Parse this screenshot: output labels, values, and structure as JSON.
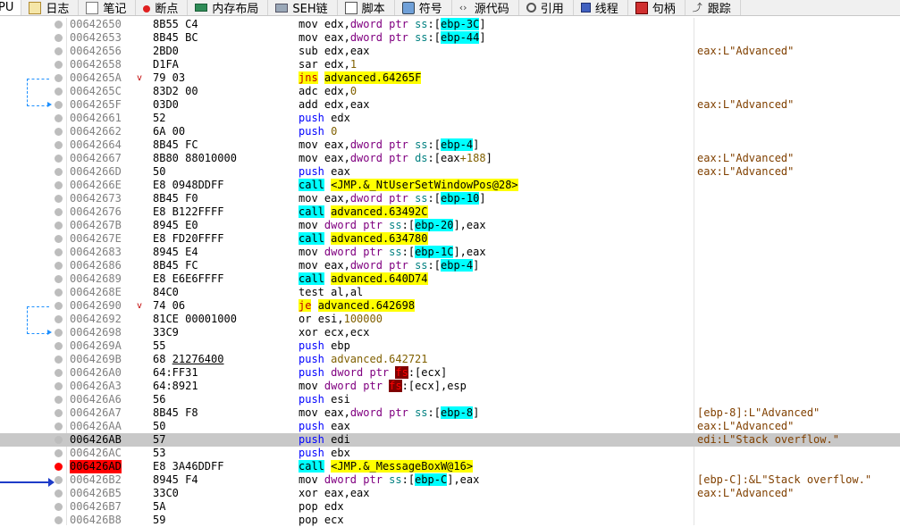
{
  "tabs": [
    {
      "label": "PU",
      "icon": "cpu-icon"
    },
    {
      "label": "日志",
      "icon": "log-icon"
    },
    {
      "label": "笔记",
      "icon": "notes-icon"
    },
    {
      "label": "断点",
      "icon": "breakpoint-icon"
    },
    {
      "label": "内存布局",
      "icon": "memory-map-icon"
    },
    {
      "label": "SEH链",
      "icon": "seh-chain-icon"
    },
    {
      "label": "脚本",
      "icon": "script-icon"
    },
    {
      "label": "符号",
      "icon": "symbols-icon"
    },
    {
      "label": "源代码",
      "icon": "source-icon"
    },
    {
      "label": "引用",
      "icon": "references-icon"
    },
    {
      "label": "线程",
      "icon": "threads-icon"
    },
    {
      "label": "句柄",
      "icon": "handles-icon"
    },
    {
      "label": "跟踪",
      "icon": "trace-icon"
    }
  ],
  "rows": [
    {
      "addr": "00642650",
      "bytes": "8B55 C4",
      "dis": [
        [
          "k",
          "mov "
        ],
        [
          "r",
          "edx"
        ],
        [
          "k",
          ","
        ],
        [
          "p",
          "dword ptr "
        ],
        [
          "s",
          "ss"
        ],
        [
          "k",
          ":"
        ],
        [
          "c",
          "["
        ],
        [
          "ch",
          "ebp-3C"
        ],
        [
          "c",
          "]"
        ]
      ],
      "cmt": ""
    },
    {
      "addr": "00642653",
      "bytes": "8B45 BC",
      "dis": [
        [
          "k",
          "mov "
        ],
        [
          "r",
          "eax"
        ],
        [
          "k",
          ","
        ],
        [
          "p",
          "dword ptr "
        ],
        [
          "s",
          "ss"
        ],
        [
          "k",
          ":"
        ],
        [
          "c",
          "["
        ],
        [
          "ch",
          "ebp-44"
        ],
        [
          "c",
          "]"
        ]
      ],
      "cmt": ""
    },
    {
      "addr": "00642656",
      "bytes": "2BD0",
      "dis": [
        [
          "k",
          "sub "
        ],
        [
          "r",
          "edx"
        ],
        [
          "k",
          ","
        ],
        [
          "r",
          "eax"
        ]
      ],
      "cmt": "eax:L\"Advanced\""
    },
    {
      "addr": "00642658",
      "bytes": "D1FA",
      "dis": [
        [
          "k",
          "sar "
        ],
        [
          "r",
          "edx"
        ],
        [
          "k",
          ","
        ],
        [
          "n",
          "1"
        ]
      ],
      "cmt": ""
    },
    {
      "addr": "0064265A",
      "bytes": "79 03",
      "mark": "v",
      "dis": [
        [
          "yj",
          "jns"
        ],
        [
          "k",
          " "
        ],
        [
          "yt",
          "advanced.64265F"
        ]
      ],
      "cmt": ""
    },
    {
      "addr": "0064265C",
      "bytes": "83D2 00",
      "dis": [
        [
          "k",
          "adc "
        ],
        [
          "r",
          "edx"
        ],
        [
          "k",
          ","
        ],
        [
          "n",
          "0"
        ]
      ],
      "cmt": ""
    },
    {
      "addr": "0064265F",
      "bytes": "03D0",
      "dis": [
        [
          "k",
          "add "
        ],
        [
          "r",
          "edx"
        ],
        [
          "k",
          ","
        ],
        [
          "r",
          "eax"
        ]
      ],
      "cmt": "eax:L\"Advanced\""
    },
    {
      "addr": "00642661",
      "bytes": "52",
      "dis": [
        [
          "b",
          "push "
        ],
        [
          "r",
          "edx"
        ]
      ],
      "cmt": ""
    },
    {
      "addr": "00642662",
      "bytes": "6A 00",
      "dis": [
        [
          "b",
          "push "
        ],
        [
          "n",
          "0"
        ]
      ],
      "cmt": ""
    },
    {
      "addr": "00642664",
      "bytes": "8B45 FC",
      "dis": [
        [
          "k",
          "mov "
        ],
        [
          "r",
          "eax"
        ],
        [
          "k",
          ","
        ],
        [
          "p",
          "dword ptr "
        ],
        [
          "s",
          "ss"
        ],
        [
          "k",
          ":"
        ],
        [
          "c",
          "["
        ],
        [
          "ch",
          "ebp-4"
        ],
        [
          "c",
          "]"
        ]
      ],
      "cmt": ""
    },
    {
      "addr": "00642667",
      "bytes": "8B80 88010000",
      "dis": [
        [
          "k",
          "mov "
        ],
        [
          "r",
          "eax"
        ],
        [
          "k",
          ","
        ],
        [
          "p",
          "dword ptr "
        ],
        [
          "s",
          "ds"
        ],
        [
          "k",
          ":["
        ],
        [
          "r",
          "eax"
        ],
        [
          "n",
          "+188"
        ],
        [
          "k",
          "]"
        ]
      ],
      "cmt": "eax:L\"Advanced\""
    },
    {
      "addr": "0064266D",
      "bytes": "50",
      "dis": [
        [
          "b",
          "push "
        ],
        [
          "r",
          "eax"
        ]
      ],
      "cmt": "eax:L\"Advanced\""
    },
    {
      "addr": "0064266E",
      "bytes": "E8 0948DDFF",
      "dis": [
        [
          "cc",
          "call"
        ],
        [
          "k",
          " "
        ],
        [
          "yt",
          "<JMP.&_NtUserSetWindowPos@28>"
        ]
      ],
      "cmt": ""
    },
    {
      "addr": "00642673",
      "bytes": "8B45 F0",
      "dis": [
        [
          "k",
          "mov "
        ],
        [
          "r",
          "eax"
        ],
        [
          "k",
          ","
        ],
        [
          "p",
          "dword ptr "
        ],
        [
          "s",
          "ss"
        ],
        [
          "k",
          ":"
        ],
        [
          "c",
          "["
        ],
        [
          "ch",
          "ebp-10"
        ],
        [
          "c",
          "]"
        ]
      ],
      "cmt": ""
    },
    {
      "addr": "00642676",
      "bytes": "E8 B122FFFF",
      "dis": [
        [
          "cc",
          "call"
        ],
        [
          "k",
          " "
        ],
        [
          "yt",
          "advanced.63492C"
        ]
      ],
      "cmt": ""
    },
    {
      "addr": "0064267B",
      "bytes": "8945 E0",
      "dis": [
        [
          "k",
          "mov "
        ],
        [
          "p",
          "dword ptr "
        ],
        [
          "s",
          "ss"
        ],
        [
          "k",
          ":"
        ],
        [
          "c",
          "["
        ],
        [
          "ch",
          "ebp-20"
        ],
        [
          "c",
          "]"
        ],
        [
          "k",
          ","
        ],
        [
          "r",
          "eax"
        ]
      ],
      "cmt": ""
    },
    {
      "addr": "0064267E",
      "bytes": "E8 FD20FFFF",
      "dis": [
        [
          "cc",
          "call"
        ],
        [
          "k",
          " "
        ],
        [
          "yt",
          "advanced.634780"
        ]
      ],
      "cmt": ""
    },
    {
      "addr": "00642683",
      "bytes": "8945 E4",
      "dis": [
        [
          "k",
          "mov "
        ],
        [
          "p",
          "dword ptr "
        ],
        [
          "s",
          "ss"
        ],
        [
          "k",
          ":"
        ],
        [
          "c",
          "["
        ],
        [
          "ch",
          "ebp-1C"
        ],
        [
          "c",
          "]"
        ],
        [
          "k",
          ","
        ],
        [
          "r",
          "eax"
        ]
      ],
      "cmt": ""
    },
    {
      "addr": "00642686",
      "bytes": "8B45 FC",
      "dis": [
        [
          "k",
          "mov "
        ],
        [
          "r",
          "eax"
        ],
        [
          "k",
          ","
        ],
        [
          "p",
          "dword ptr "
        ],
        [
          "s",
          "ss"
        ],
        [
          "k",
          ":"
        ],
        [
          "c",
          "["
        ],
        [
          "ch",
          "ebp-4"
        ],
        [
          "c",
          "]"
        ]
      ],
      "cmt": ""
    },
    {
      "addr": "00642689",
      "bytes": "E8 E6E6FFFF",
      "dis": [
        [
          "cc",
          "call"
        ],
        [
          "k",
          " "
        ],
        [
          "yt",
          "advanced.640D74"
        ]
      ],
      "cmt": ""
    },
    {
      "addr": "0064268E",
      "bytes": "84C0",
      "dis": [
        [
          "k",
          "test "
        ],
        [
          "r",
          "al"
        ],
        [
          "k",
          ","
        ],
        [
          "r",
          "al"
        ]
      ],
      "cmt": ""
    },
    {
      "addr": "00642690",
      "bytes": "74 06",
      "mark": "v",
      "dis": [
        [
          "yj",
          "je"
        ],
        [
          "k",
          " "
        ],
        [
          "yt",
          "advanced.642698"
        ]
      ],
      "cmt": ""
    },
    {
      "addr": "00642692",
      "bytes": "81CE 00001000",
      "dis": [
        [
          "k",
          "or "
        ],
        [
          "r",
          "esi"
        ],
        [
          "k",
          ","
        ],
        [
          "n",
          "100000"
        ]
      ],
      "cmt": ""
    },
    {
      "addr": "00642698",
      "bytes": "33C9",
      "dis": [
        [
          "k",
          "xor "
        ],
        [
          "r",
          "ecx"
        ],
        [
          "k",
          ","
        ],
        [
          "r",
          "ecx"
        ]
      ],
      "cmt": ""
    },
    {
      "addr": "0064269A",
      "bytes": "55",
      "dis": [
        [
          "b",
          "push "
        ],
        [
          "r",
          "ebp"
        ]
      ],
      "cmt": ""
    },
    {
      "addr": "0064269B",
      "bytes": "68 21276400",
      "ubytes": "21276400",
      "dis": [
        [
          "b",
          "push "
        ],
        [
          "n",
          "advanced.642721"
        ]
      ],
      "cmt": ""
    },
    {
      "addr": "006426A0",
      "bytes": "64:FF31",
      "dis": [
        [
          "b",
          "push "
        ],
        [
          "p",
          "dword ptr "
        ],
        [
          "rh",
          "fs"
        ],
        [
          "k",
          ":["
        ],
        [
          "r",
          "ecx"
        ],
        [
          "k",
          "]"
        ]
      ],
      "cmt": ""
    },
    {
      "addr": "006426A3",
      "bytes": "64:8921",
      "dis": [
        [
          "k",
          "mov "
        ],
        [
          "p",
          "dword ptr "
        ],
        [
          "rh",
          "fs"
        ],
        [
          "k",
          ":["
        ],
        [
          "r",
          "ecx"
        ],
        [
          "k",
          "],"
        ],
        [
          "r",
          "esp"
        ]
      ],
      "cmt": ""
    },
    {
      "addr": "006426A6",
      "bytes": "56",
      "dis": [
        [
          "b",
          "push "
        ],
        [
          "r",
          "esi"
        ]
      ],
      "cmt": ""
    },
    {
      "addr": "006426A7",
      "bytes": "8B45 F8",
      "dis": [
        [
          "k",
          "mov "
        ],
        [
          "r",
          "eax"
        ],
        [
          "k",
          ","
        ],
        [
          "p",
          "dword ptr "
        ],
        [
          "s",
          "ss"
        ],
        [
          "k",
          ":"
        ],
        [
          "c",
          "["
        ],
        [
          "ch",
          "ebp-8"
        ],
        [
          "c",
          "]"
        ]
      ],
      "cmt": "[ebp-8]:L\"Advanced\""
    },
    {
      "addr": "006426AA",
      "bytes": "50",
      "dis": [
        [
          "b",
          "push "
        ],
        [
          "r",
          "eax"
        ]
      ],
      "cmt": "eax:L\"Advanced\""
    },
    {
      "addr": "006426AB",
      "bytes": "57",
      "sel": true,
      "dis": [
        [
          "b",
          "push "
        ],
        [
          "r",
          "edi"
        ]
      ],
      "cmt": "edi:L\"Stack overflow.\""
    },
    {
      "addr": "006426AC",
      "bytes": "53",
      "dis": [
        [
          "b",
          "push "
        ],
        [
          "r",
          "ebx"
        ]
      ],
      "cmt": ""
    },
    {
      "addr": "006426AD",
      "bytes": "E8 3A46DDFF",
      "bp": true,
      "dis": [
        [
          "cc",
          "call"
        ],
        [
          "k",
          " "
        ],
        [
          "yt",
          "<JMP.&_MessageBoxW@16>"
        ]
      ],
      "cmt": ""
    },
    {
      "addr": "006426B2",
      "bytes": "8945 F4",
      "dis": [
        [
          "k",
          "mov "
        ],
        [
          "p",
          "dword ptr "
        ],
        [
          "s",
          "ss"
        ],
        [
          "k",
          ":"
        ],
        [
          "c",
          "["
        ],
        [
          "ch",
          "ebp-C"
        ],
        [
          "c",
          "]"
        ],
        [
          "k",
          ","
        ],
        [
          "r",
          "eax"
        ]
      ],
      "cmt": "[ebp-C]:&L\"Stack overflow.\""
    },
    {
      "addr": "006426B5",
      "bytes": "33C0",
      "dis": [
        [
          "k",
          "xor "
        ],
        [
          "r",
          "eax"
        ],
        [
          "k",
          ","
        ],
        [
          "r",
          "eax"
        ]
      ],
      "cmt": "eax:L\"Advanced\""
    },
    {
      "addr": "006426B7",
      "bytes": "5A",
      "dis": [
        [
          "k",
          "pop "
        ],
        [
          "r",
          "edx"
        ]
      ],
      "cmt": ""
    },
    {
      "addr": "006426B8",
      "bytes": "59",
      "dis": [
        [
          "k",
          "pop "
        ],
        [
          "r",
          "ecx"
        ]
      ],
      "cmt": ""
    }
  ]
}
